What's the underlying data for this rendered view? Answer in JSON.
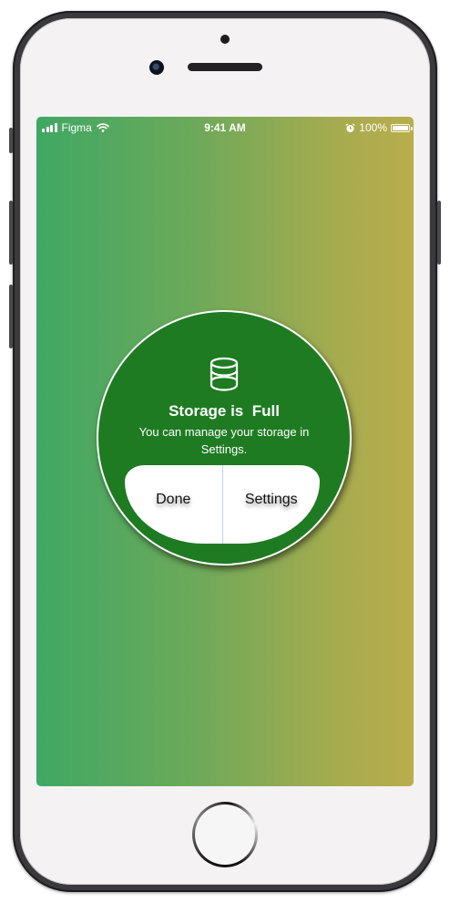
{
  "status_bar": {
    "carrier": "Figma",
    "time": "9:41 AM",
    "battery_percent": "100%",
    "battery_level": 1.0,
    "icons": [
      "signal-icon",
      "wifi-icon",
      "alarm-icon",
      "battery-icon"
    ]
  },
  "alert": {
    "icon": "database-icon",
    "title": "Storage is  Full",
    "message": "You can manage your storage in Settings.",
    "buttons": {
      "done_label": "Done",
      "settings_label": "Settings"
    }
  },
  "colors": {
    "background_gradient_start": "#3fa864",
    "background_gradient_end": "#b9ad4b",
    "alert_background": "#1e7b22",
    "button_area": "#ffffff"
  }
}
